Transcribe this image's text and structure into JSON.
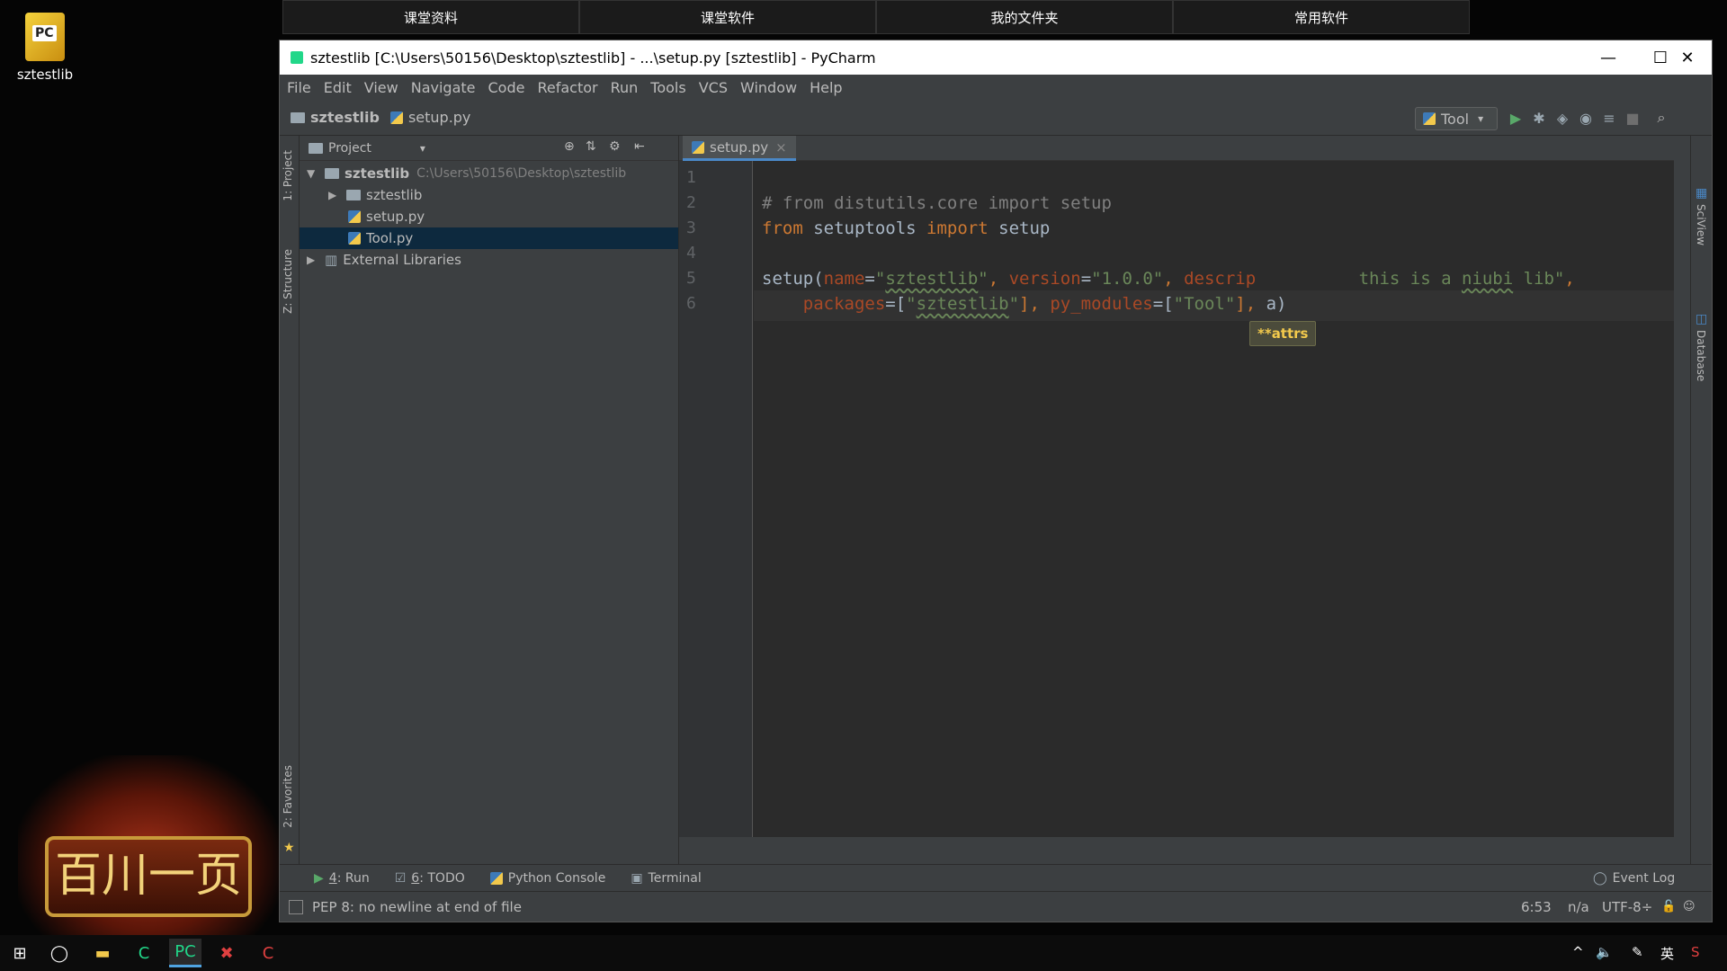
{
  "desktop": {
    "icon_label": "sztestlib",
    "deco_text": "百川一页"
  },
  "top_tabs": [
    "课堂资料",
    "课堂软件",
    "我的文件夹",
    "常用软件"
  ],
  "window": {
    "title": "sztestlib [C:\\Users\\50156\\Desktop\\sztestlib] - ...\\setup.py [sztestlib] - PyCharm",
    "minimize": "—",
    "maximize": "☐",
    "close": "✕"
  },
  "menu": [
    "File",
    "Edit",
    "View",
    "Navigate",
    "Code",
    "Refactor",
    "Run",
    "Tools",
    "VCS",
    "Window",
    "Help"
  ],
  "breadcrumb": {
    "project": "sztestlib",
    "file": "setup.py"
  },
  "toolbar": {
    "run_config": "Tool",
    "run_config_arrow": "▾"
  },
  "left_tabs": {
    "project": "1: Project",
    "structure": "Z: Structure",
    "favorites": "2: Favorites"
  },
  "right_tabs": {
    "sciview": "SciView",
    "database": "Database"
  },
  "project_panel": {
    "header": "Project",
    "header_arrow": "▾",
    "tree": [
      {
        "label": "sztestlib",
        "path": "C:\\Users\\50156\\Desktop\\sztestlib",
        "arrow": "▼"
      },
      {
        "label": "sztestlib",
        "arrow": "▶"
      },
      {
        "label": "setup.py"
      },
      {
        "label": "Tool.py"
      },
      {
        "label": "External Libraries",
        "arrow": "▶"
      }
    ]
  },
  "editor": {
    "tab_label": "setup.py",
    "tab_close": "×",
    "line_numbers": [
      "1",
      "2",
      "3",
      "4",
      "5",
      "6"
    ],
    "hint": "**attrs",
    "code": {
      "l2": "# from distutils.core import setup",
      "l3_kw1": "from",
      "l3_mod": " setuptools ",
      "l3_kw2": "import",
      "l3_name": " setup",
      "l5_fn": "setup(",
      "l5_p1": "name",
      "l5_eq1": "=",
      "l5_s1a": "\"",
      "l5_s1": "sztestlib",
      "l5_s1b": "\"",
      "l5_c1": ", ",
      "l5_p2": "version",
      "l5_eq2": "=",
      "l5_s2": "\"1.0.0\"",
      "l5_c2": ", ",
      "l5_p3": "descrip",
      "l5_gap": "          ",
      "l5_s3a": "this is a ",
      "l5_s3b": "niubi",
      "l5_s3c": " lib\"",
      "l5_c3": ",",
      "l6_indent": "    ",
      "l6_p1": "packages",
      "l6_eq1": "=[",
      "l6_s1a": "\"",
      "l6_s1": "sztestlib",
      "l6_s1b": "\"",
      "l6_c1": "], ",
      "l6_p2": "py_modules",
      "l6_eq2": "=[",
      "l6_s2": "\"Tool\"",
      "l6_c2": "], ",
      "l6_cursor": "a)"
    }
  },
  "bottom_tools": {
    "run_hotkey": "4",
    "run_label": ": Run",
    "todo_hotkey": "6",
    "todo_label": ": TODO",
    "console": "Python Console",
    "terminal": "Terminal",
    "event_log": "Event Log"
  },
  "status": {
    "message": "PEP 8: no newline at end of file",
    "position": "6:53",
    "na": "n/a",
    "encoding": "UTF-8÷"
  },
  "taskbar": {
    "ime": "英"
  }
}
